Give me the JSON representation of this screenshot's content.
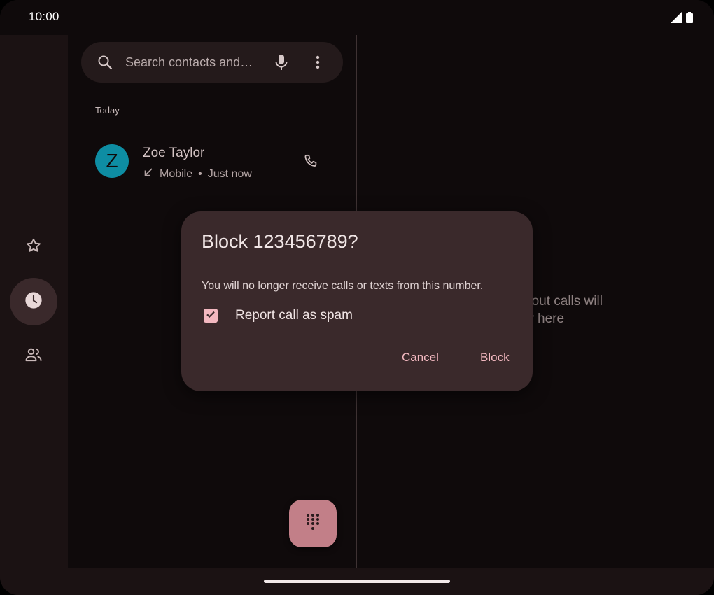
{
  "status_bar": {
    "time": "10:00",
    "icons": [
      "signal-icon",
      "battery-icon"
    ]
  },
  "nav_rail": {
    "items": [
      {
        "icon": "star-icon",
        "name": "favorites",
        "active": false
      },
      {
        "icon": "clock-icon",
        "name": "recents",
        "active": true
      },
      {
        "icon": "contacts-icon",
        "name": "contacts",
        "active": false
      }
    ]
  },
  "search": {
    "placeholder": "Search contacts and…",
    "icons": [
      "search-icon",
      "mic-icon",
      "more-vert-icon"
    ]
  },
  "recents": {
    "section_label": "Today",
    "calls": [
      {
        "initial": "Z",
        "name": "Zoe Taylor",
        "type": "Mobile",
        "time": "Just now",
        "separator": "•",
        "direction_icon": "incoming-call-arrow-icon",
        "avatar_color": "#0e8da3"
      }
    ]
  },
  "detail": {
    "empty_line1": "…bout calls will",
    "empty_line2": "…w here"
  },
  "dialog": {
    "title": "Block 123456789?",
    "body": "You will no longer receive calls or texts from this number.",
    "checkbox_label": "Report call as spam",
    "checkbox_checked": true,
    "cancel_label": "Cancel",
    "confirm_label": "Block"
  },
  "fab": {
    "icon": "dialpad-icon"
  },
  "colors": {
    "accent": "#f3b8c0",
    "fab": "#c27f88",
    "dialog": "#3a292b",
    "background": "#0f0a0b"
  }
}
